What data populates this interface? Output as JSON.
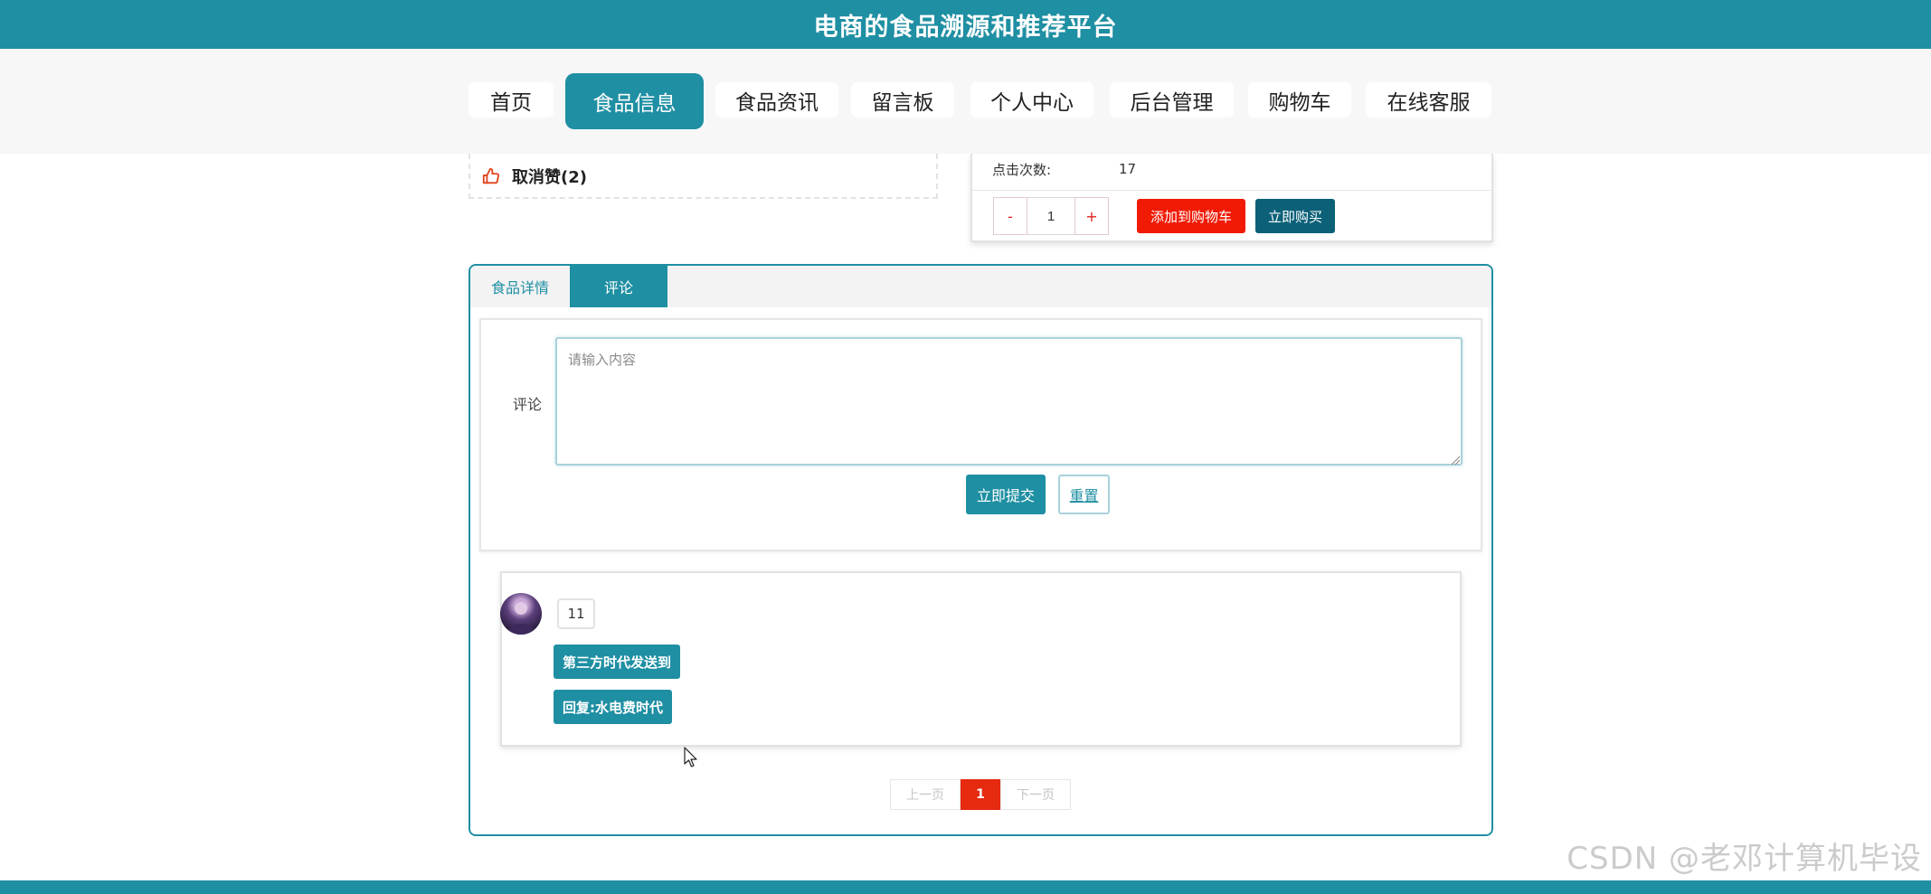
{
  "header": {
    "title": "电商的食品溯源和推荐平台"
  },
  "nav": {
    "items": [
      {
        "label": "首页"
      },
      {
        "label": "食品信息"
      },
      {
        "label": "食品资讯"
      },
      {
        "label": "留言板"
      },
      {
        "label": "个人中心"
      },
      {
        "label": "后台管理"
      },
      {
        "label": "购物车"
      },
      {
        "label": "在线客服"
      }
    ],
    "active": "食品信息"
  },
  "product": {
    "like_label": "取消赞(2)",
    "clicks_label": "点击次数:",
    "clicks_value": "17",
    "qty_minus": "-",
    "qty_value": "1",
    "qty_plus": "+",
    "add_to_cart": "添加到购物车",
    "buy_now": "立即购买"
  },
  "tabs": [
    {
      "label": "食品详情"
    },
    {
      "label": "评论"
    }
  ],
  "comment_form": {
    "label": "评论",
    "placeholder": "请输入内容",
    "submit_label": "立即提交",
    "reset_label": "重置"
  },
  "comments": [
    {
      "username": "11",
      "content": "第三方时代发送到",
      "reply": "回复:水电费时代"
    }
  ],
  "pagination": {
    "prev": "上一页",
    "current": "1",
    "next": "下一页"
  },
  "watermark": "CSDN @老邓计算机毕设",
  "colors": {
    "primary": "#1f8fa3",
    "cart_red": "#f01a05",
    "buy_dark": "#0c6178",
    "page_active": "#e52a10"
  }
}
